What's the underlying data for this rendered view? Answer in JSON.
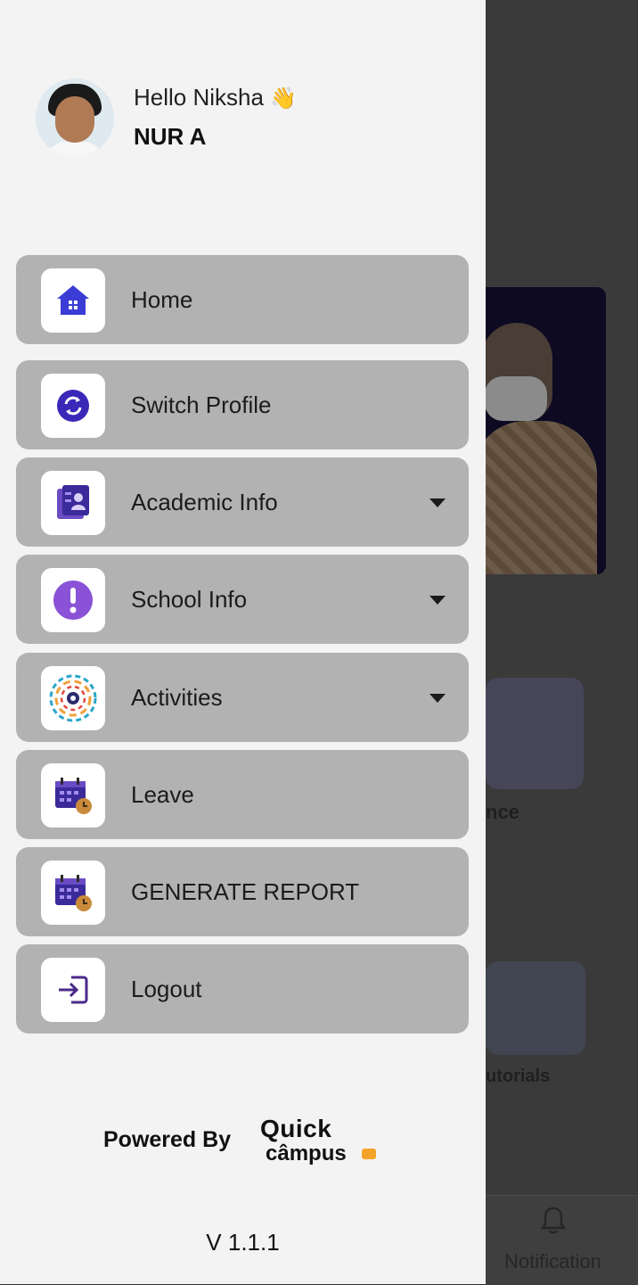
{
  "background_app": {
    "partial_label_1": "nce",
    "partial_label_2": "utorials",
    "notification_label": "Notification"
  },
  "drawer": {
    "greeting": "Hello Niksha",
    "greeting_emoji": "👋",
    "class_name": "NUR A",
    "menu": [
      {
        "label": "Home",
        "icon": "home-icon",
        "has_dropdown": false
      },
      {
        "label": "Switch Profile",
        "icon": "switch-profile-icon",
        "has_dropdown": false
      },
      {
        "label": "Academic Info",
        "icon": "academic-info-icon",
        "has_dropdown": true
      },
      {
        "label": "School Info",
        "icon": "info-icon",
        "has_dropdown": true
      },
      {
        "label": "Activities",
        "icon": "activities-icon",
        "has_dropdown": true
      },
      {
        "label": "Leave",
        "icon": "calendar-clock-icon",
        "has_dropdown": false
      },
      {
        "label": "GENERATE REPORT",
        "icon": "calendar-clock-icon",
        "has_dropdown": false
      },
      {
        "label": "Logout",
        "icon": "logout-icon",
        "has_dropdown": false
      }
    ],
    "powered_by": "Powered By",
    "logo_line1": "Quick",
    "logo_line2": "câmpus",
    "version": "V 1.1.1"
  },
  "colors": {
    "drawer_bg": "#f3f3f3",
    "menu_item_bg": "#b2b2b2",
    "accent_blue": "#3b3bd6",
    "accent_purple": "#8a52d6",
    "logo_tag": "#f4a329"
  }
}
